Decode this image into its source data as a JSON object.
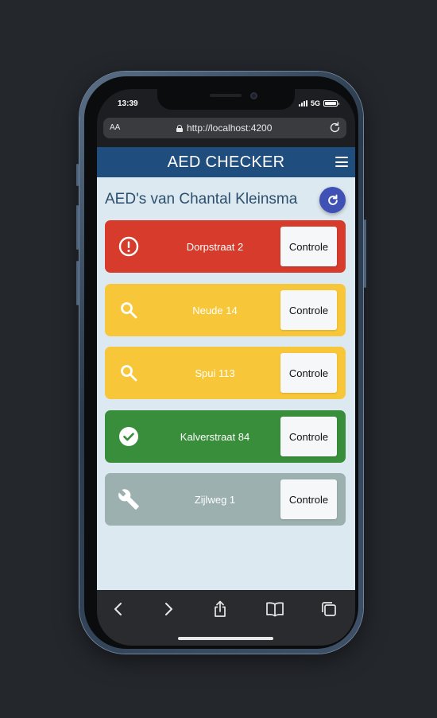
{
  "status_bar": {
    "time": "13:39",
    "network": "5G"
  },
  "browser": {
    "text_size_label": "AA",
    "url": "http://localhost:4200"
  },
  "app": {
    "title": "AED CHECKER",
    "page_title": "AED's van Chantal Kleinsma",
    "aeds": [
      {
        "address": "Dorpstraat 2",
        "status": "alert",
        "icon": "alert-circle-icon",
        "color": "#d63b2b",
        "button": "Controle"
      },
      {
        "address": "Neude 14",
        "status": "search",
        "icon": "search-icon",
        "color": "#f8c739",
        "button": "Controle"
      },
      {
        "address": "Spui 113",
        "status": "search",
        "icon": "search-icon",
        "color": "#f8c739",
        "button": "Controle"
      },
      {
        "address": "Kalverstraat 84",
        "status": "ok",
        "icon": "check-circle-icon",
        "color": "#398e3b",
        "button": "Controle"
      },
      {
        "address": "Zijlweg 1",
        "status": "maintenance",
        "icon": "wrench-icon",
        "color": "#9cb0b0",
        "button": "Controle"
      }
    ]
  },
  "colors": {
    "header": "#1f4e7e",
    "background": "#dde9f0",
    "fab": "#3f51b5"
  }
}
